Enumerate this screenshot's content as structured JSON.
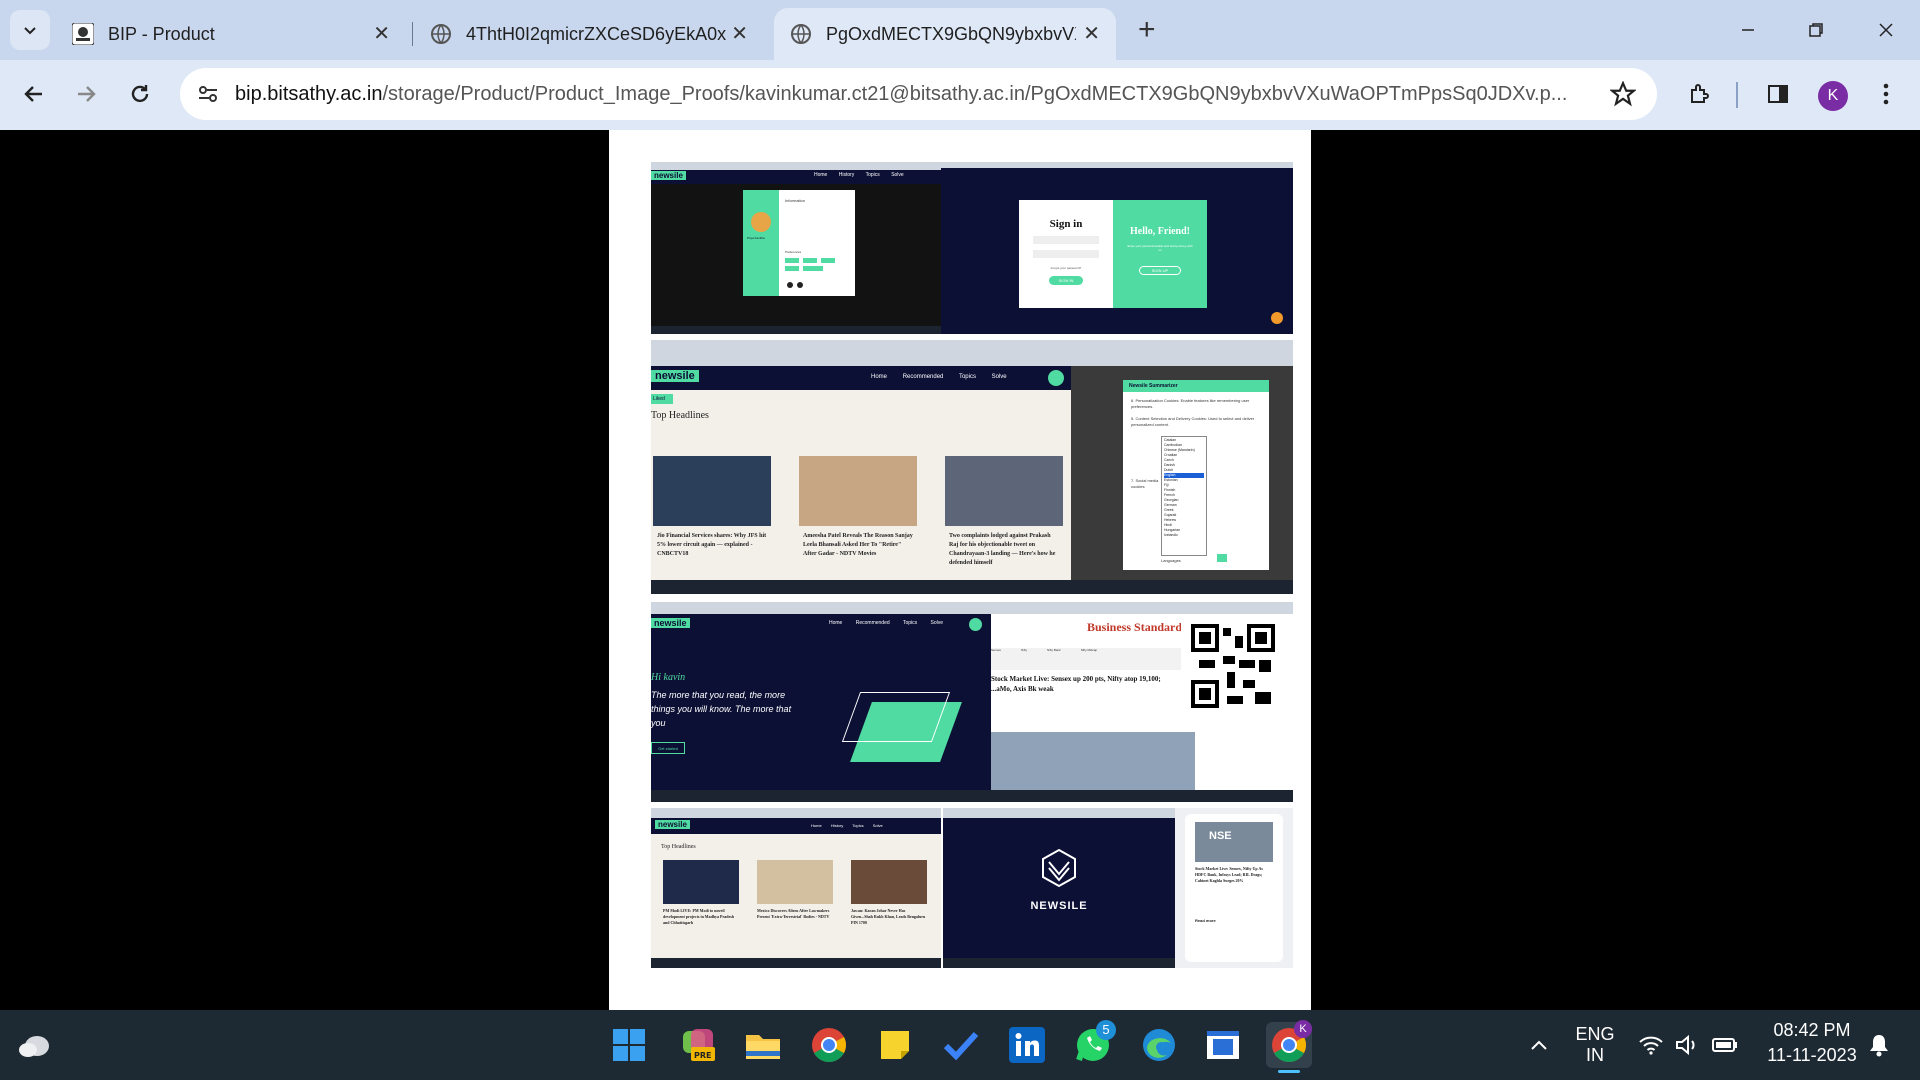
{
  "tabs": [
    {
      "title": "BIP - Product",
      "active": false
    },
    {
      "title": "4ThtH0I2qmicrZXCeSD6yEkA0x",
      "active": false
    },
    {
      "title": "PgOxdMECTX9GbQN9ybxbvVXu",
      "active": true
    }
  ],
  "address_bar": {
    "host": "bip.bitsathy.ac.in",
    "path": "/storage/Product/Product_Image_Proofs/kavinkumar.ct21@bitsathy.ac.in/PgOxdMECTX9GbQN9ybxbvVXuWaOPTmPpsSq0JDXv.p..."
  },
  "profile_initial": "K",
  "document": {
    "shot1": {
      "brand": "newsile",
      "nav": [
        "Home",
        "History",
        "Topics",
        "Solve"
      ],
      "profile_name": "Priya Kavitha",
      "section": "Information",
      "fields": [
        "Email",
        "Phone",
        "Gender",
        "Age"
      ],
      "tags_label": "Preferences"
    },
    "shot2": {
      "signin_title": "Sign in",
      "signin_btn": "SIGN IN",
      "forgot": "Forgot your password?",
      "friend_title": "Hello, Friend!",
      "friend_text": "Enter your personal details and start journey with us",
      "signup_btn": "SIGN UP"
    },
    "shot3": {
      "brand": "newsile",
      "nav": [
        "Home",
        "Recommended",
        "Topics",
        "Solve"
      ],
      "badge": "Liked",
      "heading": "Top Headlines",
      "cards": [
        "Jio Financial Services shares: Why JFS hit 5% lower circuit again — explained - CNBCTV18",
        "Ameesha Patel Reveals The Reason Sanjay Leela Bhansali Asked Her To \"Retire\" After Gadar - NDTV Movies",
        "Two complaints lodged against Prakash Raj for his objectionable tweet on Chandrayaan-3 landing — Here's how he defended himself"
      ]
    },
    "shot4": {
      "panel_title": "Newsile Summarizer",
      "items": [
        "6. Personalization Cookies: Enable features like remembering user preferences.",
        "5. Content Selection and Delivery Cookies: Used to select and deliver personalized content.",
        "7. Social media cookies"
      ],
      "languages": [
        "Catalan",
        "Cambodian",
        "Chinese (Mandarin)",
        "Croatian",
        "Czech",
        "Danish",
        "Dutch",
        "English",
        "Estonian",
        "Fiji",
        "Finnish",
        "French",
        "Georgian",
        "German",
        "Greek",
        "Gujarati",
        "Hebrew",
        "Hindi",
        "Hungarian",
        "Icelandic"
      ],
      "select_label": "Languages"
    },
    "shot5": {
      "brand": "newsile",
      "nav": [
        "Home",
        "Recommended",
        "Topics",
        "Solve"
      ],
      "greeting": "Hi kavin",
      "tagline": "The more that you read, the more things you will know. The more that you",
      "cta": "Get started"
    },
    "shot6": {
      "masthead": "Business Standard",
      "headline": "Stock Market Live: Sensex up 200 pts, Nifty atop 19,100; ...aMo, Axis Bk weak",
      "tickers": [
        "Sensex",
        "Nifty",
        "Nifty Bank",
        "Nifty Midcap"
      ]
    },
    "shot7": {
      "brand": "newsile",
      "nav": [
        "Home",
        "History",
        "Topics",
        "Solve"
      ],
      "heading": "Top Headlines",
      "cards": [
        "PM Modi LIVE: PM Modi to unveil development projects in Madhya Pradesh and Chhattisgarh",
        "Mexico Discovers Aliens After Lawmakers Present 'Extra-Terrestrial' Bodies - NDTV",
        "Jawan: Karan Johar Never Has Given...Shah Rukh Khan, Leads Bengaluru PIN 1700"
      ]
    },
    "shot8": {
      "logo_text": "NEWSILE"
    },
    "shot9": {
      "sign": "NSE",
      "headline": "Stock Market Live: Sensex, Nifty Up As HDFC Bank, Infosys Lead; RIL Drags; Cabinet Kaghla Surges 20%",
      "cta": "Read more"
    }
  },
  "taskbar": {
    "lang_top": "ENG",
    "lang_bottom": "IN",
    "time": "08:42 PM",
    "date": "11-11-2023",
    "whatsapp_badge": "5",
    "chrome_profile": "K"
  },
  "colors": {
    "accent_green": "#4fdba1",
    "dark_navy": "#0d1035",
    "tab_strip": "#c9d7ee",
    "toolbar": "#dfe8f7"
  }
}
